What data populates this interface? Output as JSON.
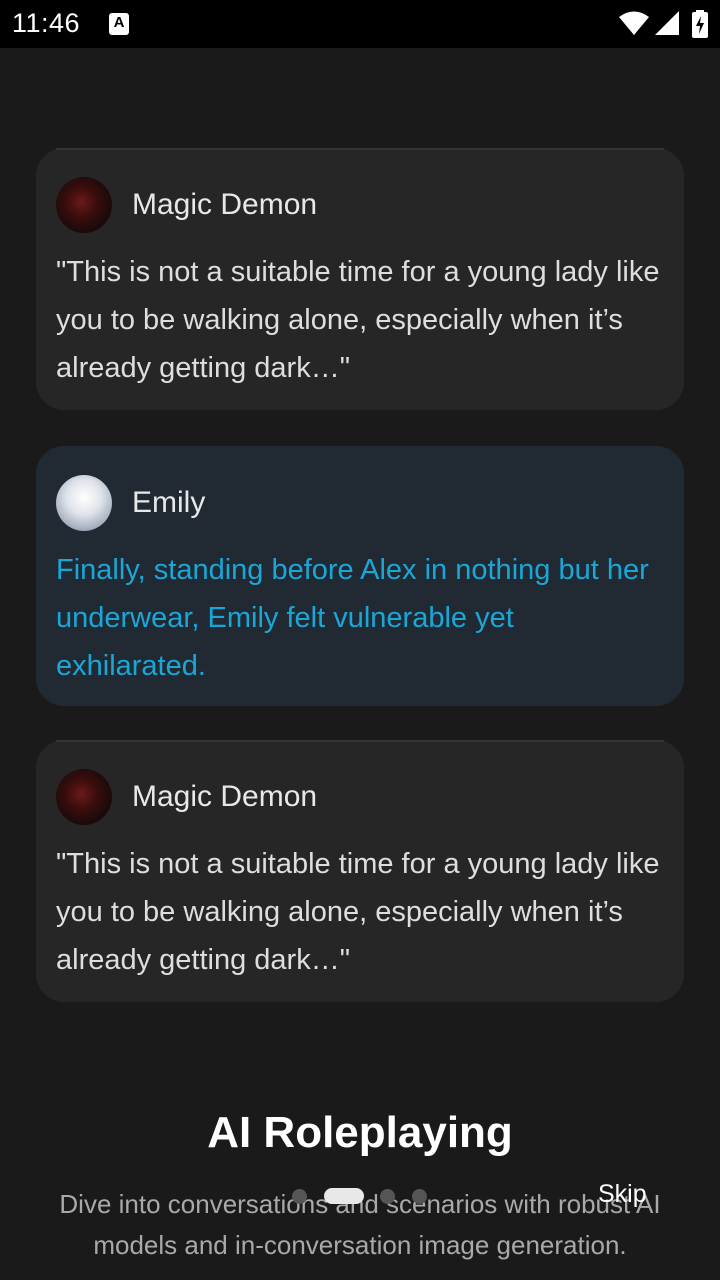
{
  "status_bar": {
    "time": "11:46",
    "notification_glyph": "A",
    "icons": [
      "wifi-icon",
      "signal-icon",
      "battery-charging-icon"
    ]
  },
  "cards": [
    {
      "name": "Magic Demon",
      "avatar": "demon-avatar",
      "text": "\"This is not a suitable time for a young lady like you to be walking alone, especially when it’s already getting dark…\""
    },
    {
      "name": "Emily",
      "avatar": "emily-avatar",
      "text": "Finally, standing before Alex in nothing but her underwear, Emily felt vulnerable yet exhilarated."
    },
    {
      "name": "Magic Demon",
      "avatar": "demon-avatar",
      "text": "\"This is not a suitable time for a young lady like you to be walking alone, especially when it’s already getting dark…\""
    }
  ],
  "onboarding": {
    "title": "AI Roleplaying",
    "subtitle": "Dive into conversations and scenarios with robust AI models and in-conversation image generation.",
    "skip_label": "Skip",
    "page_index": 2,
    "page_count": 4
  },
  "colors": {
    "background": "#1a1a1a",
    "card": "#262626",
    "user_card": "#212a33",
    "user_text": "#1aa7d8"
  }
}
